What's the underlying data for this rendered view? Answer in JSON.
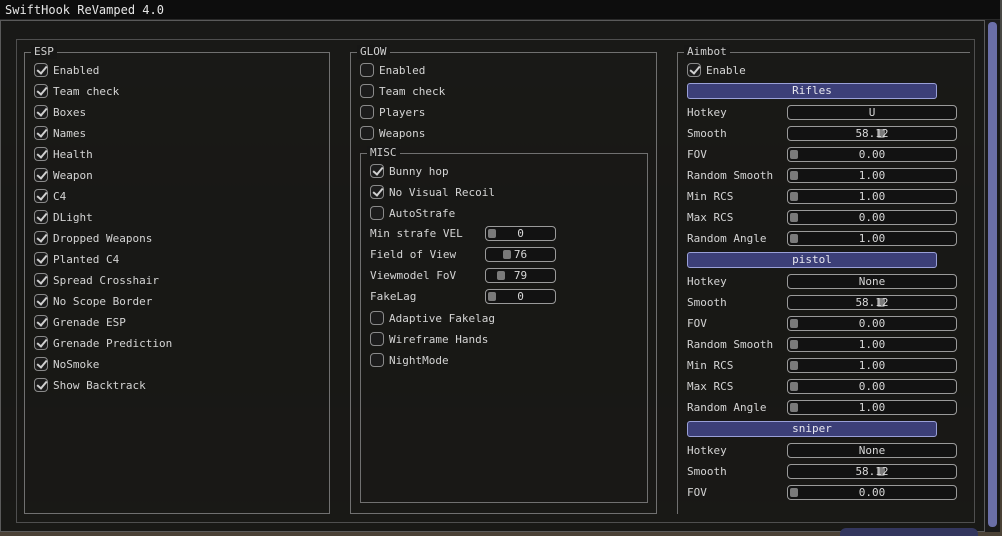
{
  "window": {
    "title": "SwiftHook ReVamped 4.0"
  },
  "esp": {
    "title": "ESP",
    "items": [
      {
        "label": "Enabled",
        "checked": true
      },
      {
        "label": "Team check",
        "checked": true
      },
      {
        "label": "Boxes",
        "checked": true
      },
      {
        "label": "Names",
        "checked": true
      },
      {
        "label": "Health",
        "checked": true
      },
      {
        "label": "Weapon",
        "checked": true
      },
      {
        "label": "C4",
        "checked": true
      },
      {
        "label": "DLight",
        "checked": true
      },
      {
        "label": "Dropped Weapons",
        "checked": true
      },
      {
        "label": "Planted C4",
        "checked": true
      },
      {
        "label": "Spread Crosshair",
        "checked": true
      },
      {
        "label": "No Scope Border",
        "checked": true
      },
      {
        "label": "Grenade ESP",
        "checked": true
      },
      {
        "label": "Grenade Prediction",
        "checked": true
      },
      {
        "label": "NoSmoke",
        "checked": true
      },
      {
        "label": "Show Backtrack",
        "checked": true
      }
    ]
  },
  "glow": {
    "title": "GLOW",
    "items": [
      {
        "label": "Enabled",
        "checked": false
      },
      {
        "label": "Team check",
        "checked": false
      },
      {
        "label": "Players",
        "checked": false
      },
      {
        "label": "Weapons",
        "checked": false
      }
    ]
  },
  "misc": {
    "title": "MISC",
    "checks1": [
      {
        "label": "Bunny hop",
        "checked": true
      },
      {
        "label": "No Visual Recoil",
        "checked": true
      },
      {
        "label": "AutoStrafe",
        "checked": false
      }
    ],
    "sliders": [
      {
        "label": "Min strafe VEL",
        "value": "0",
        "level": 0.0
      },
      {
        "label": "Field of View",
        "value": "76",
        "level": 0.27
      },
      {
        "label": "Viewmodel FoV",
        "value": "79",
        "level": 0.15
      },
      {
        "label": "FakeLag",
        "value": "0",
        "level": 0.0
      }
    ],
    "checks2": [
      {
        "label": "Adaptive Fakelag",
        "checked": false
      },
      {
        "label": "Wireframe Hands",
        "checked": false
      },
      {
        "label": "NightMode",
        "checked": false
      }
    ]
  },
  "aimbot": {
    "title": "Aimbot",
    "enable": {
      "label": "Enable",
      "checked": true
    },
    "sections": [
      {
        "header": "Rifles",
        "hotkey": {
          "label": "Hotkey",
          "value": "U"
        },
        "sliders": [
          {
            "label": "Smooth",
            "value": "58.12",
            "level": 0.56
          },
          {
            "label": "FOV",
            "value": "0.00",
            "level": 0.0
          },
          {
            "label": "Random Smooth",
            "value": "1.00",
            "level": 0.0
          },
          {
            "label": "Min RCS",
            "value": "1.00",
            "level": 0.0
          },
          {
            "label": "Max RCS",
            "value": "0.00",
            "level": 0.0
          },
          {
            "label": "Random Angle",
            "value": "1.00",
            "level": 0.0
          }
        ]
      },
      {
        "header": "pistol",
        "hotkey": {
          "label": "Hotkey",
          "value": "None"
        },
        "sliders": [
          {
            "label": "Smooth",
            "value": "58.12",
            "level": 0.56
          },
          {
            "label": "FOV",
            "value": "0.00",
            "level": 0.0
          },
          {
            "label": "Random Smooth",
            "value": "1.00",
            "level": 0.0
          },
          {
            "label": "Min RCS",
            "value": "1.00",
            "level": 0.0
          },
          {
            "label": "Max RCS",
            "value": "0.00",
            "level": 0.0
          },
          {
            "label": "Random Angle",
            "value": "1.00",
            "level": 0.0
          }
        ]
      },
      {
        "header": "sniper",
        "hotkey": {
          "label": "Hotkey",
          "value": "None"
        },
        "sliders": [
          {
            "label": "Smooth",
            "value": "58.12",
            "level": 0.56
          },
          {
            "label": "FOV",
            "value": "0.00",
            "level": 0.0
          }
        ]
      }
    ]
  }
}
